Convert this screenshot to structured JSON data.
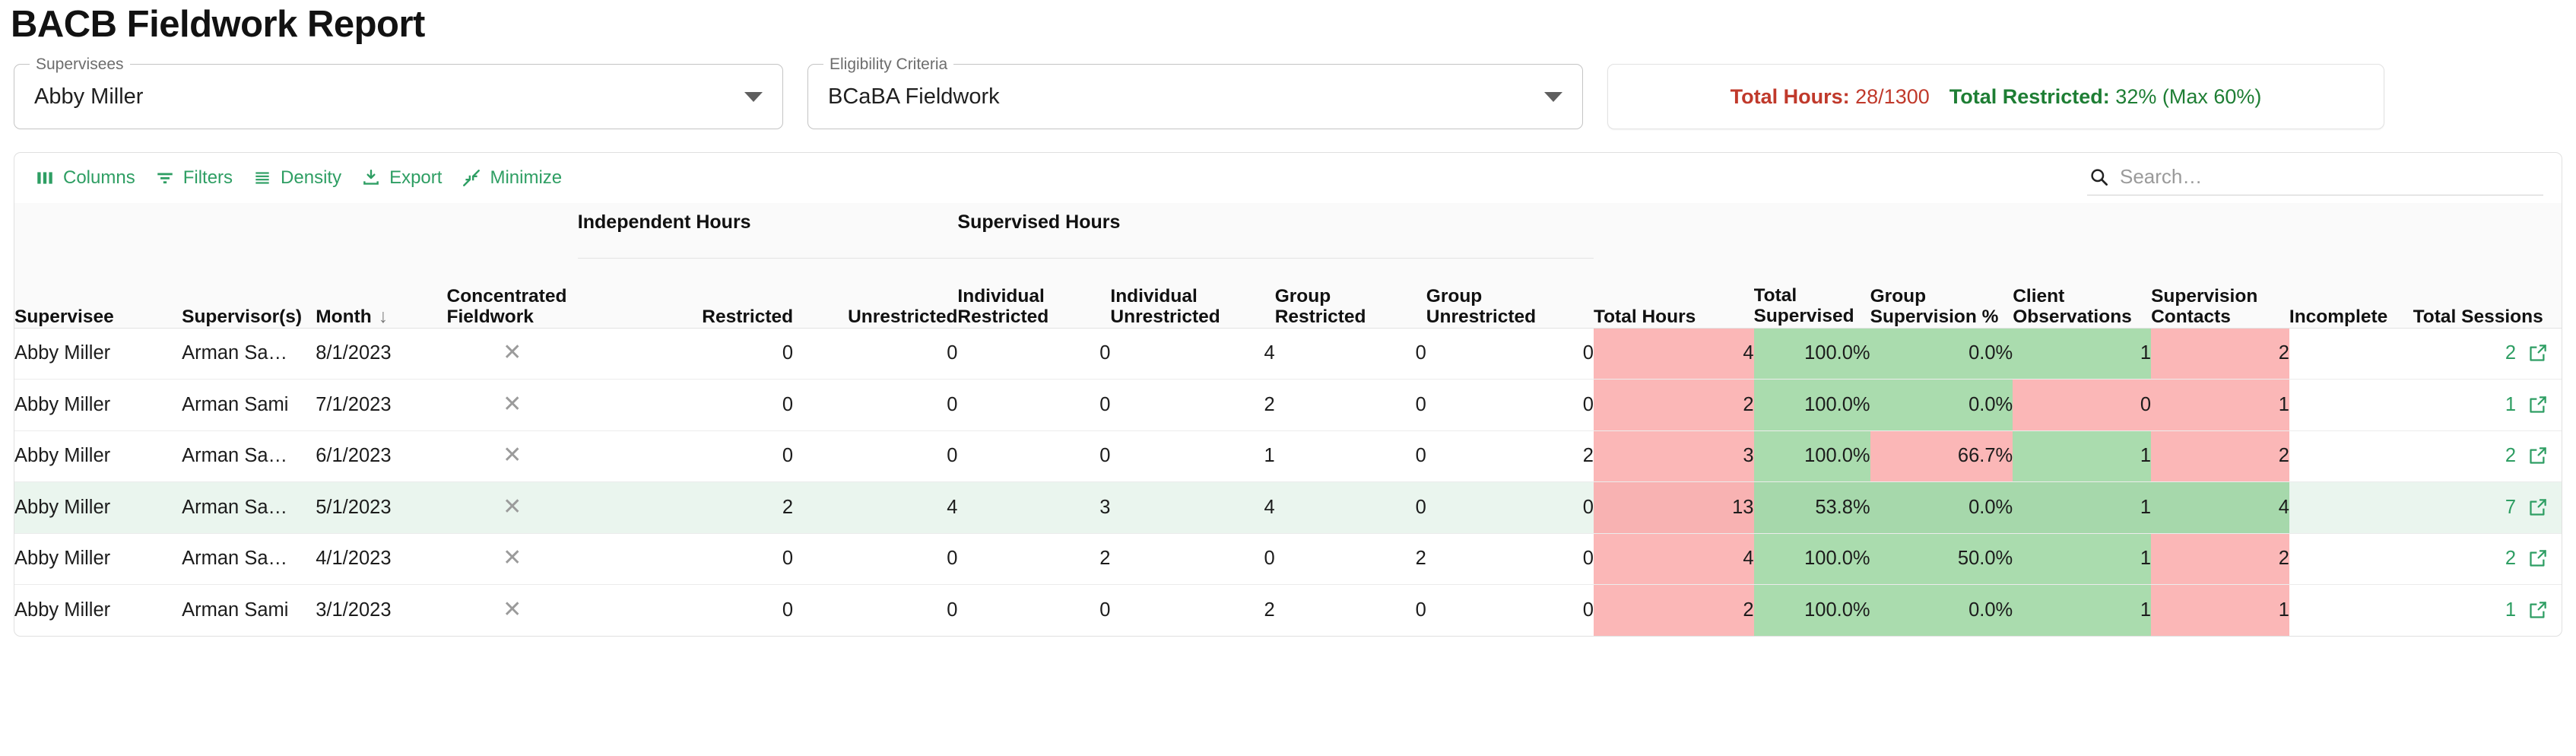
{
  "page": {
    "title": "BACB Fieldwork Report"
  },
  "filters": {
    "supervisee": {
      "legend": "Supervisees",
      "value": "Abby Miller"
    },
    "criteria": {
      "legend": "Eligibility Criteria",
      "value": "BCaBA Fieldwork"
    }
  },
  "stats": {
    "total_hours_label": "Total Hours:",
    "total_hours_value": "28/1300",
    "total_restricted_label": "Total Restricted:",
    "total_restricted_value": "32% (Max 60%)",
    "red": "#c0392b",
    "green": "#1e7e34"
  },
  "toolbar": {
    "columns": "Columns",
    "filters": "Filters",
    "density": "Density",
    "export": "Export",
    "minimize": "Minimize",
    "search_placeholder": "Search…",
    "search_value": "",
    "accent": "#2e9e63"
  },
  "table": {
    "group_headers": {
      "independent": "Independent Hours",
      "supervised": "Supervised Hours"
    },
    "columns": [
      "Supervisee",
      "Supervisor(s)",
      "Month",
      "Concentrated Fieldwork",
      "Restricted",
      "Unrestricted",
      "Individual Restricted",
      "Individual Unrestricted",
      "Group Restricted",
      "Group Unrestricted",
      "Total Hours",
      "Total Supervised %",
      "Group Supervision %",
      "Client Observations",
      "Supervision Contacts",
      "Incomplete",
      "Total Sessions"
    ],
    "sort_column": "Month",
    "sort_arrow": "↓",
    "rows": [
      {
        "supervisee": "Abby Miller",
        "supervisor": "Arman Sa…",
        "month": "8/1/2023",
        "concentrated": "✕",
        "ind_restricted": "0",
        "ind_unrestricted": "0",
        "sup_ind_restricted": "0",
        "sup_ind_unrestricted": "4",
        "sup_grp_restricted": "0",
        "sup_grp_unrestricted": "0",
        "total_hours": "4",
        "total_supervised_pct": "100.0%",
        "group_supervision_pct": "0.0%",
        "client_observations": "1",
        "supervision_contacts": "2",
        "incomplete": "",
        "total_sessions": "2",
        "colors": {
          "total_hours": "red",
          "total_supervised_pct": "green",
          "group_supervision_pct": "green",
          "client_observations": "green",
          "supervision_contacts": "red"
        },
        "hovered": false
      },
      {
        "supervisee": "Abby Miller",
        "supervisor": "Arman Sami",
        "month": "7/1/2023",
        "concentrated": "✕",
        "ind_restricted": "0",
        "ind_unrestricted": "0",
        "sup_ind_restricted": "0",
        "sup_ind_unrestricted": "2",
        "sup_grp_restricted": "0",
        "sup_grp_unrestricted": "0",
        "total_hours": "2",
        "total_supervised_pct": "100.0%",
        "group_supervision_pct": "0.0%",
        "client_observations": "0",
        "supervision_contacts": "1",
        "incomplete": "",
        "total_sessions": "1",
        "colors": {
          "total_hours": "red",
          "total_supervised_pct": "green",
          "group_supervision_pct": "green",
          "client_observations": "red",
          "supervision_contacts": "red"
        },
        "hovered": false
      },
      {
        "supervisee": "Abby Miller",
        "supervisor": "Arman Sa…",
        "month": "6/1/2023",
        "concentrated": "✕",
        "ind_restricted": "0",
        "ind_unrestricted": "0",
        "sup_ind_restricted": "0",
        "sup_ind_unrestricted": "1",
        "sup_grp_restricted": "0",
        "sup_grp_unrestricted": "2",
        "total_hours": "3",
        "total_supervised_pct": "100.0%",
        "group_supervision_pct": "66.7%",
        "client_observations": "1",
        "supervision_contacts": "2",
        "incomplete": "",
        "total_sessions": "2",
        "colors": {
          "total_hours": "red",
          "total_supervised_pct": "green",
          "group_supervision_pct": "red",
          "client_observations": "green",
          "supervision_contacts": "red"
        },
        "hovered": false
      },
      {
        "supervisee": "Abby Miller",
        "supervisor": "Arman Sa…",
        "month": "5/1/2023",
        "concentrated": "✕",
        "ind_restricted": "2",
        "ind_unrestricted": "4",
        "sup_ind_restricted": "3",
        "sup_ind_unrestricted": "4",
        "sup_grp_restricted": "0",
        "sup_grp_unrestricted": "0",
        "total_hours": "13",
        "total_supervised_pct": "53.8%",
        "group_supervision_pct": "0.0%",
        "client_observations": "1",
        "supervision_contacts": "4",
        "incomplete": "",
        "total_sessions": "7",
        "colors": {
          "total_hours": "red",
          "total_supervised_pct": "green",
          "group_supervision_pct": "green",
          "client_observations": "green",
          "supervision_contacts": "green"
        },
        "hovered": true
      },
      {
        "supervisee": "Abby Miller",
        "supervisor": "Arman Sa…",
        "month": "4/1/2023",
        "concentrated": "✕",
        "ind_restricted": "0",
        "ind_unrestricted": "0",
        "sup_ind_restricted": "2",
        "sup_ind_unrestricted": "0",
        "sup_grp_restricted": "2",
        "sup_grp_unrestricted": "0",
        "total_hours": "4",
        "total_supervised_pct": "100.0%",
        "group_supervision_pct": "50.0%",
        "client_observations": "1",
        "supervision_contacts": "2",
        "incomplete": "",
        "total_sessions": "2",
        "colors": {
          "total_hours": "red",
          "total_supervised_pct": "green",
          "group_supervision_pct": "green",
          "client_observations": "green",
          "supervision_contacts": "red"
        },
        "hovered": false
      },
      {
        "supervisee": "Abby Miller",
        "supervisor": "Arman Sami",
        "month": "3/1/2023",
        "concentrated": "✕",
        "ind_restricted": "0",
        "ind_unrestricted": "0",
        "sup_ind_restricted": "0",
        "sup_ind_unrestricted": "2",
        "sup_grp_restricted": "0",
        "sup_grp_unrestricted": "0",
        "total_hours": "2",
        "total_supervised_pct": "100.0%",
        "group_supervision_pct": "0.0%",
        "client_observations": "1",
        "supervision_contacts": "1",
        "incomplete": "",
        "total_sessions": "1",
        "colors": {
          "total_hours": "red",
          "total_supervised_pct": "green",
          "group_supervision_pct": "green",
          "client_observations": "green",
          "supervision_contacts": "red"
        },
        "hovered": false
      }
    ]
  }
}
